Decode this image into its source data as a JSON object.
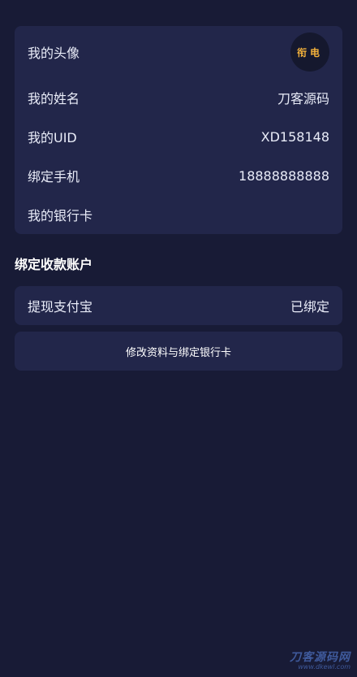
{
  "profile": {
    "avatar_label": "我的头像",
    "avatar_text": "衔电",
    "name_label": "我的姓名",
    "name_value": "刀客源码",
    "uid_label": "我的UID",
    "uid_value": "XD158148",
    "phone_label": "绑定手机",
    "phone_value": "18888888888",
    "bank_label": "我的银行卡",
    "bank_value": ""
  },
  "payment_section": {
    "title": "绑定收款账户",
    "alipay_label": "提现支付宝",
    "alipay_status": "已绑定"
  },
  "actions": {
    "edit_button_label": "修改资料与绑定银行卡"
  },
  "watermark": {
    "main": "刀客源码网",
    "sub": "www.dkewl.com"
  },
  "colors": {
    "background": "#181b36",
    "card": "#22264a",
    "avatar_text": "#f3b13b",
    "watermark": "#3f5a9c"
  }
}
